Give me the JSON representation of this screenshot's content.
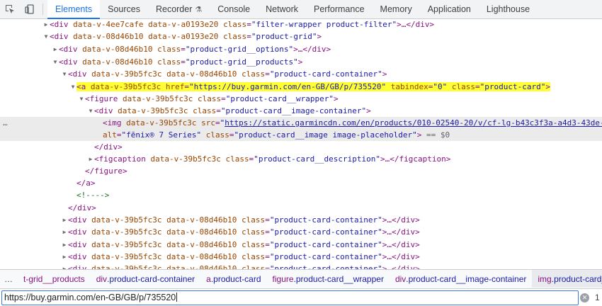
{
  "tabs": [
    {
      "label": "Elements",
      "active": true
    },
    {
      "label": "Sources"
    },
    {
      "label": "Recorder",
      "icon": "flask-icon"
    },
    {
      "label": "Console"
    },
    {
      "label": "Network"
    },
    {
      "label": "Performance"
    },
    {
      "label": "Memory"
    },
    {
      "label": "Application"
    },
    {
      "label": "Lighthouse"
    }
  ],
  "tools": {
    "inspect_icon": "inspect-element-icon",
    "device_icon": "device-toolbar-icon"
  },
  "colors": {
    "accent": "#1a73e8",
    "tag": "#881280",
    "attr_name": "#994500",
    "attr_value": "#1a1aa6",
    "highlight": "#ffff33",
    "comment": "#236e25"
  },
  "tree": {
    "r0": {
      "tag": "div",
      "a1": "data-v-4ee7cafe",
      "a2": "data-v-a0193e20",
      "cls": "filter-wrapper product-filter",
      "tail": ">…</div>"
    },
    "r1": {
      "tag": "div",
      "a1": "data-v-08d46b10",
      "a2": "data-v-a0193e20",
      "cls": "product-grid",
      "tail": ">"
    },
    "r2": {
      "tag": "div",
      "a1": "data-v-08d46b10",
      "cls": "product-grid__options",
      "tail": ">…</div>"
    },
    "r3": {
      "tag": "div",
      "a1": "data-v-08d46b10",
      "cls": "product-grid__products",
      "tail": ">"
    },
    "r4": {
      "tag": "div",
      "a1": "data-v-39b5fc3c",
      "a2": "data-v-08d46b10",
      "cls": "product-card-container",
      "tail": ">"
    },
    "r5": {
      "tag": "a",
      "a1": "data-v-39b5fc3c",
      "href": "https://buy.garmin.com/en-GB/GB/p/735520",
      "tabindex": "0",
      "cls": "product-card",
      "tail": ">"
    },
    "r6": {
      "tag": "figure",
      "a1": "data-v-39b5fc3c",
      "cls": "product-card__wrapper",
      "tail": ">"
    },
    "r7": {
      "tag": "div",
      "a1": "data-v-39b5fc3c",
      "cls": "product-card__image-container",
      "tail": ">"
    },
    "r8": {
      "tag": "img",
      "a1": "data-v-39b5fc3c",
      "src": "https://static.garmincdn.com/en/products/010-02540-20/v/cf-lg-b43c3f3a-a4d3-43de-"
    },
    "r9": {
      "alt": "fēnix® 7 Series",
      "cls": "product-card__image image-placeholder",
      "tail": ">",
      "eq": "== $0"
    },
    "r10": {
      "close": "</div>"
    },
    "r11": {
      "tag": "figcaption",
      "a1": "data-v-39b5fc3c",
      "cls": "product-card__description",
      "tail": ">…</figcaption>"
    },
    "r12": {
      "close": "</figure>"
    },
    "r13": {
      "close": "</a>"
    },
    "r14": {
      "comment": "<!---->"
    },
    "r15": {
      "close": "</div>"
    },
    "rc": {
      "tag": "div",
      "a1": "data-v-39b5fc3c",
      "a2": "data-v-08d46b10",
      "cls": "product-card-container",
      "tail": ">…</div>"
    }
  },
  "breadcrumbs": {
    "more": "…",
    "items": [
      {
        "tag": "",
        "cls": "t-grid__products"
      },
      {
        "tag": "div",
        "cls": ".product-card-container"
      },
      {
        "tag": "a",
        "cls": ".product-card"
      },
      {
        "tag": "figure",
        "cls": ".product-card__wrapper"
      },
      {
        "tag": "div",
        "cls": ".product-card__image-container"
      },
      {
        "tag": "img",
        "cls": ".product-card__i"
      }
    ]
  },
  "search": {
    "value": "https://buy.garmin.com/en-GB/GB/p/735520",
    "match_count": "1"
  }
}
